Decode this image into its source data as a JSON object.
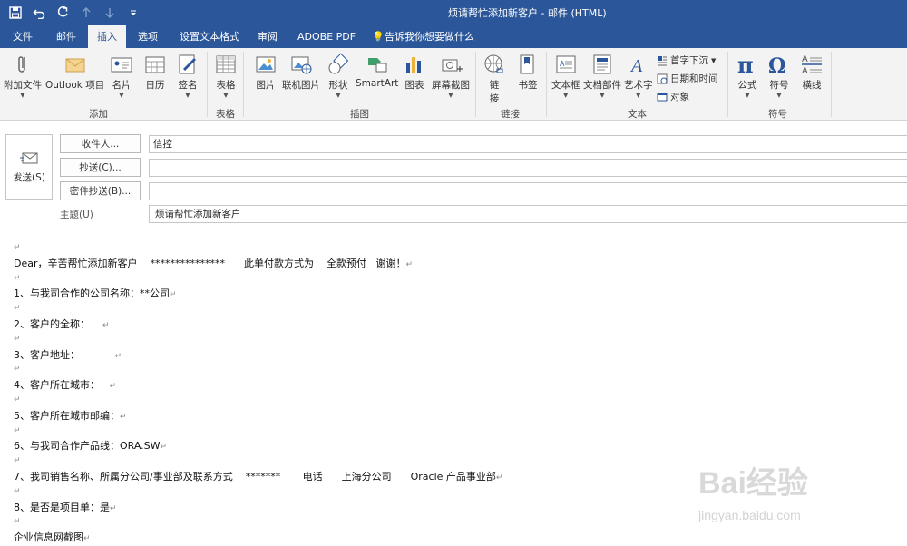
{
  "window": {
    "title": "烦请帮忙添加新客户  -  邮件 (HTML)"
  },
  "quick_access": [
    "save-icon",
    "undo-icon",
    "redo-icon",
    "up-icon",
    "down-icon",
    "customize-icon"
  ],
  "tabs": [
    {
      "label": "文件"
    },
    {
      "label": "邮件"
    },
    {
      "label": "插入"
    },
    {
      "label": "选项"
    },
    {
      "label": "设置文本格式"
    },
    {
      "label": "审阅"
    },
    {
      "label": "ADOBE PDF"
    },
    {
      "label": "告诉我你想要做什么"
    }
  ],
  "ribbon": {
    "groups": {
      "add": "添加",
      "table": "表格",
      "illustrations": "插图",
      "links": "链接",
      "text": "文本",
      "symbols": "符号"
    },
    "buttons": {
      "attach": "附加文件",
      "outlook_item": "Outlook 项目",
      "card": "名片",
      "calendar": "日历",
      "signature": "签名",
      "table": "表格",
      "picture": "图片",
      "online_picture": "联机图片",
      "shapes": "形状",
      "smartart": "SmartArt",
      "chart": "图表",
      "screenshot": "屏幕截图",
      "link1": "链",
      "link2": "接",
      "bookmark": "书签",
      "textbox": "文本框",
      "quickparts": "文档部件",
      "wordart": "艺术字",
      "dropcap": "首字下沉",
      "datetime": "日期和时间",
      "object": "对象",
      "equation": "公式",
      "symbol": "符号",
      "hline": "横线"
    }
  },
  "header": {
    "send": "发送(S)",
    "to_label": "收件人...",
    "to_value": "信控",
    "cc_label": "抄送(C)...",
    "bcc_label": "密件抄送(B)...",
    "subject_label": "主题(U)",
    "subject_value": "烦请帮忙添加新客户"
  },
  "body": {
    "lines": [
      "",
      "Dear，辛苦帮忙添加新客户    ***************      此单付款方式为    全款预付   谢谢！",
      "",
      "1、与我司合作的公司名称：**公司",
      "",
      "2、客户的全称：    ",
      "",
      "3、客户地址：           ",
      "",
      "4、客户所在城市：   ",
      "",
      "5、客户所在城市邮编：",
      "",
      "6、与我司合作产品线：ORA.SW",
      "",
      "7、我司销售名称、所属分公司/事业部及联系方式    *******       电话      上海分公司      Oracle 产品事业部",
      "",
      "8、是否是项目单：是",
      "",
      "企业信息网截图"
    ],
    "paragraph_mark": "↵"
  },
  "watermark": {
    "main": "Bai经验",
    "sub": "jingyan.baidu.com"
  },
  "colors": {
    "accent": "#2b579a",
    "ribbon_bg": "#f3f3f3"
  }
}
